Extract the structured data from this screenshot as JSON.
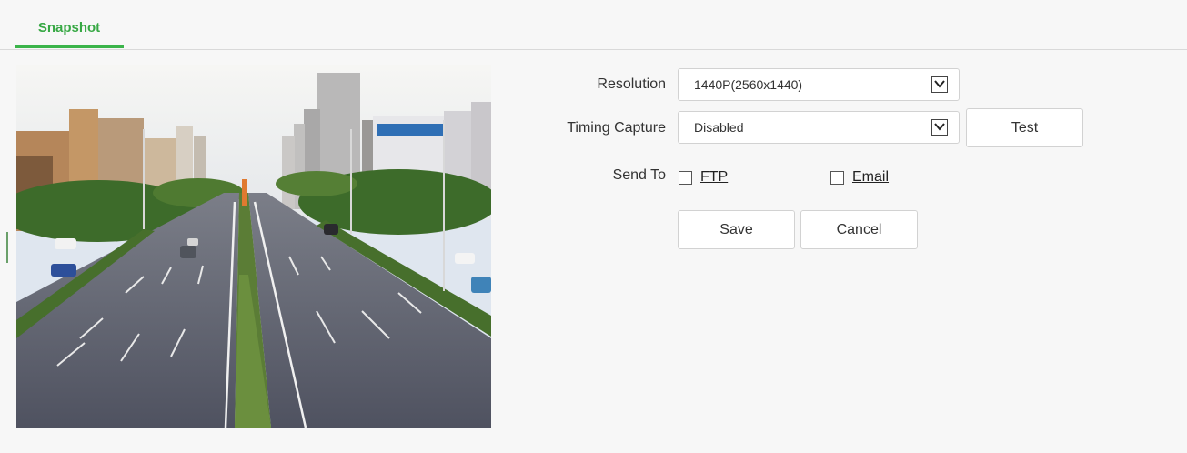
{
  "tabs": [
    {
      "label": "Snapshot",
      "active": true
    }
  ],
  "form": {
    "resolution": {
      "label": "Resolution",
      "value": "1440P(2560x1440)"
    },
    "timing_capture": {
      "label": "Timing Capture",
      "value": "Disabled",
      "test_label": "Test"
    },
    "send_to": {
      "label": "Send To",
      "options": [
        {
          "label": "FTP",
          "checked": false
        },
        {
          "label": "Email",
          "checked": false
        }
      ]
    },
    "save_label": "Save",
    "cancel_label": "Cancel"
  },
  "colors": {
    "accent": "#3bb44a",
    "background": "#f7f7f7",
    "border": "#d2d2d2"
  },
  "icons": {
    "dropdown": "chevron-down-icon"
  }
}
